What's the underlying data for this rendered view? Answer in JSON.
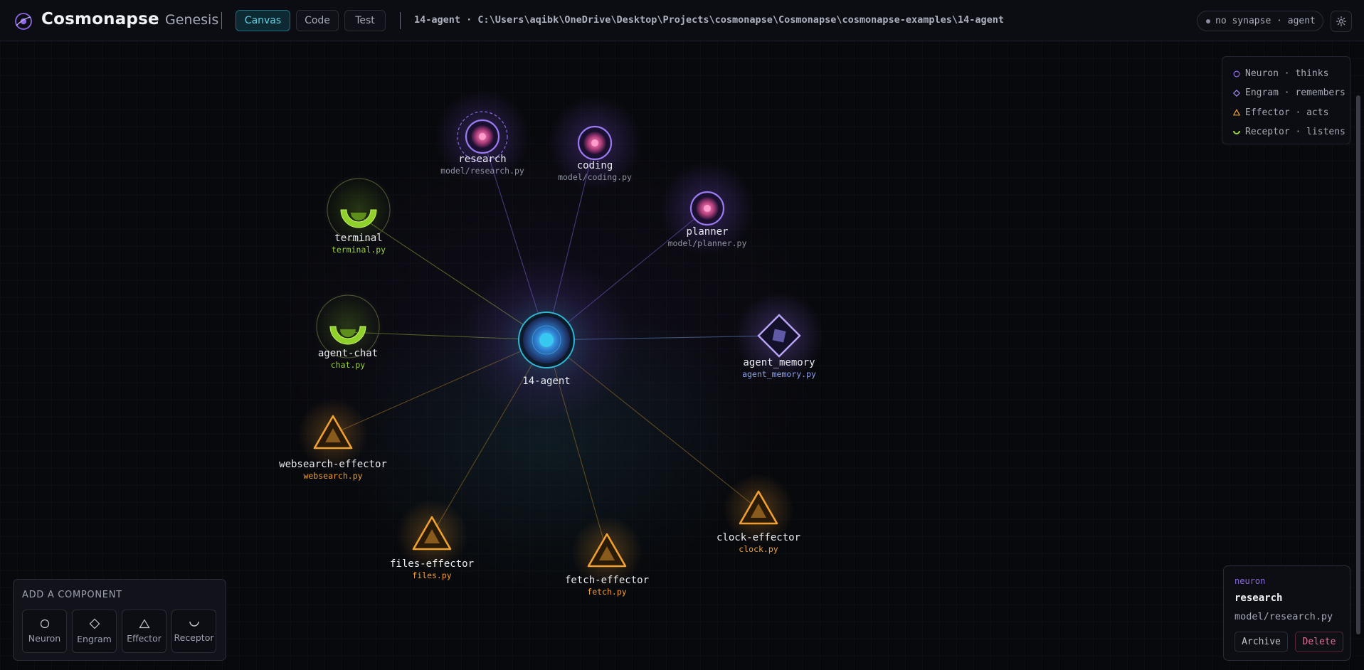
{
  "app": {
    "brand": "Cosmonapse",
    "subtitle": "Genesis",
    "logo_icon": "cosmonapse-logo-icon"
  },
  "tabs": [
    {
      "label": "Canvas",
      "active": true
    },
    {
      "label": "Code",
      "active": false
    },
    {
      "label": "Test",
      "active": false
    }
  ],
  "project": {
    "path": "14-agent · C:\\Users\\aqibk\\OneDrive\\Desktop\\Projects\\cosmonapse\\Cosmonapse\\cosmonapse-examples\\14-agent"
  },
  "status": {
    "text": "no synapse · agent"
  },
  "settings": {
    "icon": "gear-icon"
  },
  "legend": [
    {
      "label": "Neuron · thinks",
      "shape": "circle",
      "color": "#8b67e6"
    },
    {
      "label": "Engram · remembers",
      "shape": "diamond",
      "color": "#a58cf0"
    },
    {
      "label": "Effector · acts",
      "shape": "triangle",
      "color": "#f0a030"
    },
    {
      "label": "Receptor · listens",
      "shape": "cup",
      "color": "#9ad33a"
    }
  ],
  "graph": {
    "center": {
      "name": "14-agent"
    },
    "nodes": [
      {
        "id": "research",
        "kind": "neuron",
        "name": "research",
        "file": "model/research.py",
        "selected": true
      },
      {
        "id": "coding",
        "kind": "neuron",
        "name": "coding",
        "file": "model/coding.py"
      },
      {
        "id": "planner",
        "kind": "neuron",
        "name": "planner",
        "file": "model/planner.py"
      },
      {
        "id": "terminal",
        "kind": "receptor",
        "name": "terminal",
        "file": "terminal.py"
      },
      {
        "id": "agent-chat",
        "kind": "receptor",
        "name": "agent-chat",
        "file": "chat.py"
      },
      {
        "id": "agent-memory",
        "kind": "engram",
        "name": "agent_memory",
        "file": "agent_memory.py"
      },
      {
        "id": "websearch-effector",
        "kind": "effector",
        "name": "websearch-effector",
        "file": "websearch.py"
      },
      {
        "id": "files-effector",
        "kind": "effector",
        "name": "files-effector",
        "file": "files.py"
      },
      {
        "id": "fetch-effector",
        "kind": "effector",
        "name": "fetch-effector",
        "file": "fetch.py"
      },
      {
        "id": "clock-effector",
        "kind": "effector",
        "name": "clock-effector",
        "file": "clock.py"
      }
    ],
    "colors": {
      "neuron": "#8b67e6",
      "engram": "#a58cf0",
      "effector": "#f0a030",
      "receptor": "#9ad33a",
      "center": "#2fb8d6"
    }
  },
  "add_panel": {
    "title": "ADD A COMPONENT",
    "buttons": [
      {
        "label": "Neuron",
        "icon": "circle-icon"
      },
      {
        "label": "Engram",
        "icon": "diamond-icon"
      },
      {
        "label": "Effector",
        "icon": "triangle-icon"
      },
      {
        "label": "Receptor",
        "icon": "cup-icon"
      }
    ]
  },
  "inspector": {
    "kind": "neuron",
    "name": "research",
    "file": "model/research.py",
    "archive_label": "Archive",
    "delete_label": "Delete"
  }
}
